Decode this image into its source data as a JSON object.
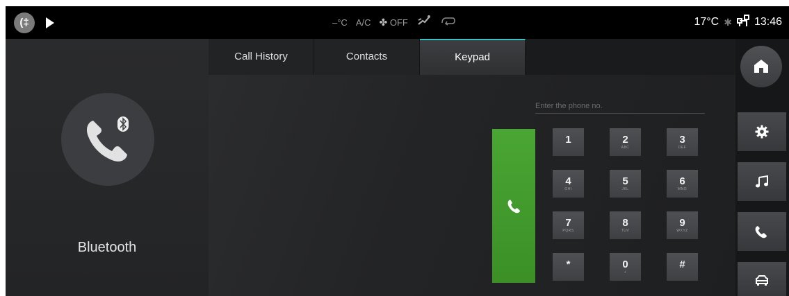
{
  "status_bar": {
    "foglight_icon": "front-fog-light-icon",
    "play_icon": "play-icon",
    "temp_unset": "–°C",
    "ac_label": "A/C",
    "fan_label": "OFF",
    "airflow_icon": "air-direction-icon",
    "recirc_icon": "air-recirculation-icon",
    "outside_temp": "17°C",
    "bluetooth_icon": "bluetooth-icon",
    "network_icon": "network-icon",
    "time": "13:46"
  },
  "left_panel": {
    "icon": "bluetooth-phone-icon",
    "title": "Bluetooth"
  },
  "tabs": [
    {
      "label": "Call History",
      "active": false
    },
    {
      "label": "Contacts",
      "active": false
    },
    {
      "label": "Keypad",
      "active": true
    }
  ],
  "dialer": {
    "placeholder": "Enter the phone no.",
    "value": "",
    "call_icon": "phone-call-icon",
    "call_color": "#43a02d",
    "keys": [
      {
        "digit": "1",
        "letters": ""
      },
      {
        "digit": "2",
        "letters": "ABC"
      },
      {
        "digit": "3",
        "letters": "DEF"
      },
      {
        "digit": "4",
        "letters": "GHI"
      },
      {
        "digit": "5",
        "letters": "JKL"
      },
      {
        "digit": "6",
        "letters": "MNO"
      },
      {
        "digit": "7",
        "letters": "PQRS"
      },
      {
        "digit": "8",
        "letters": "TUV"
      },
      {
        "digit": "9",
        "letters": "WXYZ"
      },
      {
        "digit": "*",
        "letters": ""
      },
      {
        "digit": "0",
        "letters": "+"
      },
      {
        "digit": "#",
        "letters": ""
      }
    ]
  },
  "right_nav": {
    "items": [
      {
        "icon": "home-icon"
      },
      {
        "icon": "settings-icon"
      },
      {
        "icon": "music-icon"
      },
      {
        "icon": "phone-icon",
        "active": true
      },
      {
        "icon": "car-icon"
      }
    ]
  },
  "accent_color": "#3fc1c3"
}
